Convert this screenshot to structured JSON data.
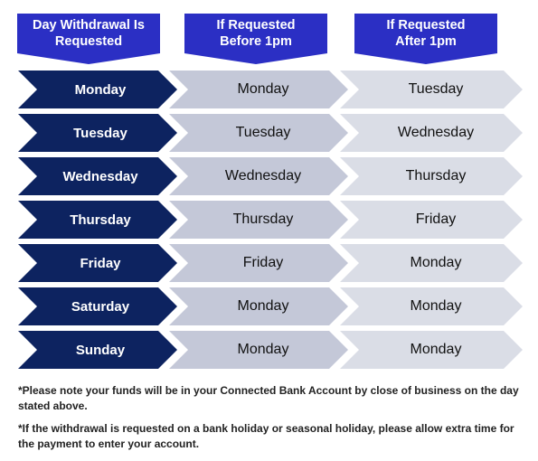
{
  "headers": [
    {
      "line1": "Day Withdrawal Is",
      "line2": "Requested"
    },
    {
      "line1": "If Requested",
      "line2": "Before 1pm"
    },
    {
      "line1": "If Requested",
      "line2": "After 1pm"
    }
  ],
  "rows": [
    {
      "day": "Monday",
      "before": "Monday",
      "after": "Tuesday"
    },
    {
      "day": "Tuesday",
      "before": "Tuesday",
      "after": "Wednesday"
    },
    {
      "day": "Wednesday",
      "before": "Wednesday",
      "after": "Thursday"
    },
    {
      "day": "Thursday",
      "before": "Thursday",
      "after": "Friday"
    },
    {
      "day": "Friday",
      "before": "Friday",
      "after": "Monday"
    },
    {
      "day": "Saturday",
      "before": "Monday",
      "after": "Monday"
    },
    {
      "day": "Sunday",
      "before": "Monday",
      "after": "Monday"
    }
  ],
  "notes": [
    "*Please note your funds will be in your Connected Bank Account by close of business on the day stated above.",
    "*If the withdrawal is requested on a bank holiday or seasonal holiday, please allow extra time for the payment to enter your account."
  ],
  "colors": {
    "header": "#2b2fc4",
    "day_column": "#0d2360",
    "before_column": "#c4c8d8",
    "after_column": "#dadde6"
  }
}
